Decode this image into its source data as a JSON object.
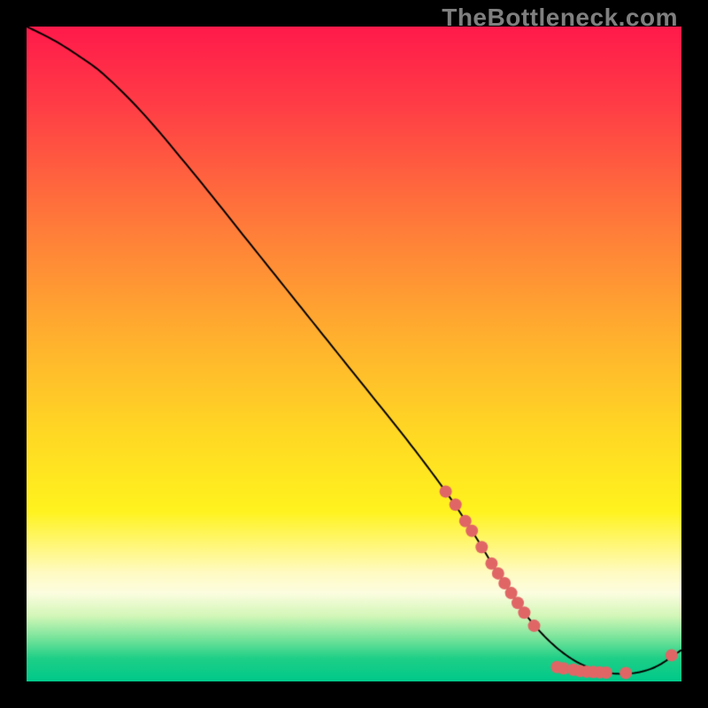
{
  "watermark": "TheBottleneck.com",
  "chart_data": {
    "type": "line",
    "title": "",
    "xlabel": "",
    "ylabel": "",
    "xlim": [
      0,
      100
    ],
    "ylim": [
      0,
      100
    ],
    "grid": false,
    "legend": false,
    "gradient_stops": [
      {
        "t": 0.0,
        "color": "#ff1a4b"
      },
      {
        "t": 0.12,
        "color": "#ff3d46"
      },
      {
        "t": 0.3,
        "color": "#ff7a3a"
      },
      {
        "t": 0.48,
        "color": "#ffb22e"
      },
      {
        "t": 0.62,
        "color": "#ffd824"
      },
      {
        "t": 0.74,
        "color": "#fff31e"
      },
      {
        "t": 0.835,
        "color": "#fffbc4"
      },
      {
        "t": 0.865,
        "color": "#fcfde0"
      },
      {
        "t": 0.9,
        "color": "#d3f7b8"
      },
      {
        "t": 0.935,
        "color": "#74e39a"
      },
      {
        "t": 0.965,
        "color": "#1ecf87"
      },
      {
        "t": 1.0,
        "color": "#00c98a"
      }
    ],
    "series": [
      {
        "name": "bottleneck-curve",
        "x": [
          0,
          4,
          8,
          12,
          18,
          26,
          34,
          42,
          50,
          58,
          64,
          68,
          72,
          76,
          80,
          84,
          88,
          92,
          96,
          100
        ],
        "y": [
          100,
          98,
          95.5,
          92.5,
          86.5,
          77,
          67,
          57,
          47,
          37,
          29,
          23,
          16.5,
          10.5,
          6,
          3,
          1.5,
          1.2,
          2.2,
          4.8
        ],
        "color": "#000000",
        "linewidth": 2
      }
    ],
    "markers": {
      "name": "highlight-points",
      "color": "#e06666",
      "radius": 7,
      "points": [
        {
          "x": 64,
          "y": 29
        },
        {
          "x": 65.5,
          "y": 27
        },
        {
          "x": 67,
          "y": 24.5
        },
        {
          "x": 68,
          "y": 23
        },
        {
          "x": 69.5,
          "y": 20.5
        },
        {
          "x": 71,
          "y": 18
        },
        {
          "x": 72,
          "y": 16.5
        },
        {
          "x": 73,
          "y": 15
        },
        {
          "x": 74,
          "y": 13.5
        },
        {
          "x": 75,
          "y": 12
        },
        {
          "x": 76,
          "y": 10.5
        },
        {
          "x": 77.5,
          "y": 8.5
        },
        {
          "x": 81,
          "y": 2.2
        },
        {
          "x": 82,
          "y": 2.0
        },
        {
          "x": 83.5,
          "y": 1.8
        },
        {
          "x": 84.5,
          "y": 1.6
        },
        {
          "x": 85.5,
          "y": 1.5
        },
        {
          "x": 86.5,
          "y": 1.45
        },
        {
          "x": 87.5,
          "y": 1.4
        },
        {
          "x": 88.5,
          "y": 1.35
        },
        {
          "x": 91.5,
          "y": 1.3
        },
        {
          "x": 98.5,
          "y": 4.0
        }
      ]
    }
  }
}
